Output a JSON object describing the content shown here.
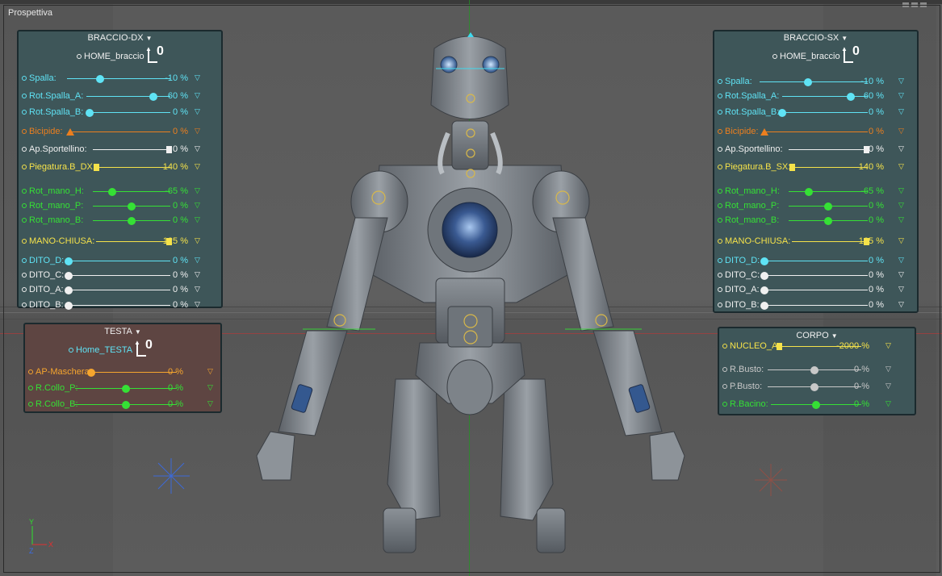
{
  "viewport": {
    "title": "Prospettiva"
  },
  "colors": {
    "white": "#f0f0f0",
    "cyan": "#5fe3f5",
    "orange": "#ec7f1e",
    "yellow": "#f5e24a",
    "green": "#35e035",
    "gray": "#c8c8c8",
    "orange_light": "#f5a52e"
  },
  "panels": {
    "braccio_dx": {
      "title": "BRACCIO-DX",
      "home": "HOME_braccio",
      "home_num": "0",
      "rows": [
        {
          "label": "Spalla:",
          "value": "-10 %",
          "color": "cyan",
          "pos": 0.32
        },
        {
          "label": "Rot.Spalla_A:",
          "value": "60 %",
          "color": "cyan",
          "pos": 0.8
        },
        {
          "label": "Rot.Spalla_B:",
          "value": "0 %",
          "color": "cyan",
          "pos": 0.0
        },
        {
          "label": "Bicipide:",
          "value": "0 %",
          "color": "orange",
          "pos": 0.0
        },
        {
          "label": "Ap.Sportellino:",
          "value": "0 %",
          "color": "white",
          "pos": 1.0
        },
        {
          "label": "Piegatura.B_DX:",
          "value": "140 %",
          "color": "yellow",
          "pos": 0.0
        },
        {
          "label": "Rot_mano_H:",
          "value": "-65 %",
          "color": "green",
          "pos": 0.25
        },
        {
          "label": "Rot_mano_P:",
          "value": "0 %",
          "color": "green",
          "pos": 0.5
        },
        {
          "label": "Rot_mano_B:",
          "value": "0 %",
          "color": "green",
          "pos": 0.5
        },
        {
          "label": "MANO-CHIUSA:",
          "value": "125 %",
          "color": "yellow",
          "pos": 1.0
        },
        {
          "label": "DITO_D:",
          "value": "0 %",
          "color": "cyan",
          "pos": 0.0
        },
        {
          "label": "DITO_C:",
          "value": "0 %",
          "color": "white",
          "pos": 0.0
        },
        {
          "label": "DITO_A:",
          "value": "0 %",
          "color": "white",
          "pos": 0.0
        },
        {
          "label": "DITO_B:",
          "value": "0 %",
          "color": "white",
          "pos": 0.0
        }
      ]
    },
    "braccio_sx": {
      "title": "BRACCIO-SX",
      "home": "HOME_braccio",
      "home_num": "0",
      "rows": [
        {
          "label": "Spalla:",
          "value": "-10 %",
          "color": "cyan",
          "pos": 0.45
        },
        {
          "label": "Rot.Spalla_A:",
          "value": "60 %",
          "color": "cyan",
          "pos": 0.8
        },
        {
          "label": "Rot.Spalla_B:",
          "value": "0 %",
          "color": "cyan",
          "pos": 0.0
        },
        {
          "label": "Bicipide:",
          "value": "0 %",
          "color": "orange",
          "pos": 0.0
        },
        {
          "label": "Ap.Sportellino:",
          "value": "0 %",
          "color": "white",
          "pos": 1.0
        },
        {
          "label": "Piegatura.B_SX:",
          "value": "140 %",
          "color": "yellow",
          "pos": 0.0
        },
        {
          "label": "Rot_mano_H:",
          "value": "-65 %",
          "color": "green",
          "pos": 0.25
        },
        {
          "label": "Rot_mano_P:",
          "value": "0 %",
          "color": "green",
          "pos": 0.5
        },
        {
          "label": "Rot_mano_B:",
          "value": "0 %",
          "color": "green",
          "pos": 0.5
        },
        {
          "label": "MANO-CHIUSA:",
          "value": "125 %",
          "color": "yellow",
          "pos": 1.0
        },
        {
          "label": "DITO_D:",
          "value": "0 %",
          "color": "cyan",
          "pos": 0.0
        },
        {
          "label": "DITO_C:",
          "value": "0 %",
          "color": "white",
          "pos": 0.0
        },
        {
          "label": "DITO_A:",
          "value": "0 %",
          "color": "white",
          "pos": 0.0
        },
        {
          "label": "DITO_B:",
          "value": "0 %",
          "color": "white",
          "pos": 0.0
        }
      ]
    },
    "testa": {
      "title": "TESTA",
      "home": "Home_TESTA",
      "home_num": "0",
      "rows": [
        {
          "label": "AP-Maschera:",
          "value": "0 %",
          "color": "orange_light",
          "pos": 0.0
        },
        {
          "label": "R.Collo_P:",
          "value": "0 %",
          "color": "green",
          "pos": 0.5
        },
        {
          "label": "R.Collo_B:",
          "value": "0 %",
          "color": "green",
          "pos": 0.5
        }
      ]
    },
    "corpo": {
      "title": "CORPO",
      "rows": [
        {
          "label": "NUCLEO_A:",
          "value": "-2000 %",
          "color": "yellow",
          "pos": 0.0
        },
        {
          "label": "R.Busto:",
          "value": "0 %",
          "color": "gray",
          "pos": 0.5
        },
        {
          "label": "P.Busto:",
          "value": "0 %",
          "color": "gray",
          "pos": 0.5
        },
        {
          "label": "R.Bacino:",
          "value": "0 %",
          "color": "green",
          "pos": 0.5
        }
      ]
    }
  },
  "gizmo": {
    "y": "Y",
    "x": "X",
    "z": "Z"
  }
}
